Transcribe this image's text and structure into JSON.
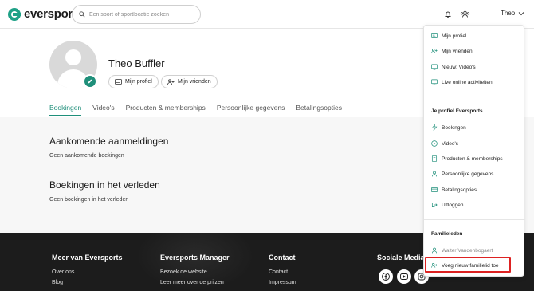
{
  "header": {
    "logo_text": "eversports",
    "search_placeholder": "Een sport of sportlocatie zoeken",
    "user_name": "Theo",
    "icons": [
      "bell-icon",
      "friends-icon",
      "chevron-down-icon"
    ]
  },
  "profile": {
    "name": "Theo Buffler",
    "buttons": {
      "my_profile": "Mijn profiel",
      "my_friends": "Mijn vrienden"
    }
  },
  "tabs": [
    {
      "label": "Bookingen",
      "active": true
    },
    {
      "label": "Video's",
      "active": false
    },
    {
      "label": "Producten & memberships",
      "active": false
    },
    {
      "label": "Persoonlijke gegevens",
      "active": false
    },
    {
      "label": "Betalingsopties",
      "active": false
    }
  ],
  "content": {
    "upcoming_title": "Aankomende aanmeldingen",
    "upcoming_empty": "Geen aankomende boekingen",
    "past_title": "Boekingen in het verleden",
    "past_empty": "Geen boekingen in het verleden"
  },
  "footer": {
    "col1_title": "Meer van Eversports",
    "col1_links": [
      "Over ons",
      "Blog"
    ],
    "col2_title": "Eversports Manager",
    "col2_links": [
      "Bezoek de website",
      "Leer meer over de prijzen"
    ],
    "col3_title": "Contact",
    "col3_links": [
      "Contact",
      "Impressum"
    ],
    "col4_title": "Sociale Media",
    "social_icons": [
      "facebook-icon",
      "youtube-icon",
      "instagram-icon"
    ]
  },
  "dropdown": {
    "top_items": [
      "Mijn profiel",
      "Mijn vrienden",
      "Nieuw: Video's",
      "Live online activiteiten"
    ],
    "profile_heading": "Je profiel Eversports",
    "profile_items": [
      "Boekingen",
      "Video's",
      "Producten & memberships",
      "Persoonlijke gegevens",
      "Betalingsopties",
      "Uitloggen"
    ],
    "family_heading": "Familieleden",
    "family_member": "Walter Vandenbogaert",
    "add_family": "Voeg nieuw familielid toe"
  },
  "colors": {
    "accent": "#1f8f7a",
    "highlight": "#dd2222",
    "footer_bg": "#1c1c1c"
  }
}
